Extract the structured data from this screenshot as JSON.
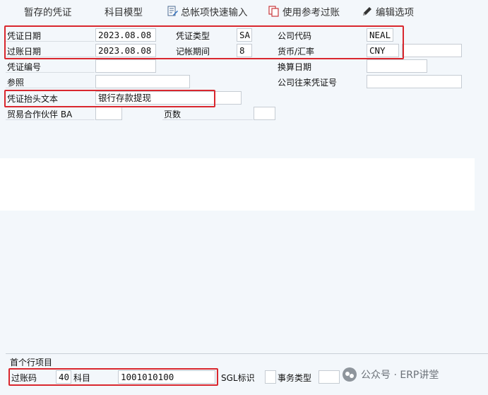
{
  "toolbar": {
    "hold_label": "暂存的凭证",
    "account_model_label": "科目模型",
    "quick_entry_label": "总帐项快速输入",
    "reference_label": "使用参考过账",
    "edit_options_label": "编辑选项"
  },
  "header": {
    "doc_date": {
      "label": "凭证日期",
      "value": "2023.08.08"
    },
    "doc_type": {
      "label": "凭证类型",
      "value": "SA"
    },
    "company_code": {
      "label": "公司代码",
      "value": "NEAL"
    },
    "posting_date": {
      "label": "过账日期",
      "value": "2023.08.08"
    },
    "period": {
      "label": "记帐期间",
      "value": "8"
    },
    "currency": {
      "label": "货币/汇率",
      "value": "CNY",
      "rate": ""
    },
    "doc_number": {
      "label": "凭证编号",
      "value": ""
    },
    "translation_date": {
      "label": "换算日期",
      "value": ""
    },
    "reference": {
      "label": "参照",
      "value": ""
    },
    "cross_company": {
      "label": "公司往来凭证号",
      "value": ""
    },
    "header_text": {
      "label": "凭证抬头文本",
      "value": "银行存款提现"
    },
    "trading_partner": {
      "label": "贸易合作伙伴 BA",
      "value": ""
    },
    "page_count": {
      "label": "页数",
      "value": ""
    }
  },
  "first_line": {
    "title": "首个行项目",
    "posting_key_label": "过账码",
    "posting_key": "40",
    "account_label": "科目",
    "account": "1001010100",
    "sgl_label": "SGL标识",
    "sgl_value": "",
    "transaction_type_label": "事务类型",
    "transaction_type_value": ""
  },
  "watermark": {
    "text": "公众号 · ERP讲堂"
  },
  "colors": {
    "highlight": "#d9272e",
    "background": "#f3f7fb"
  },
  "icons": [
    "quick-entry-icon",
    "reference-icon",
    "pencil-icon"
  ]
}
